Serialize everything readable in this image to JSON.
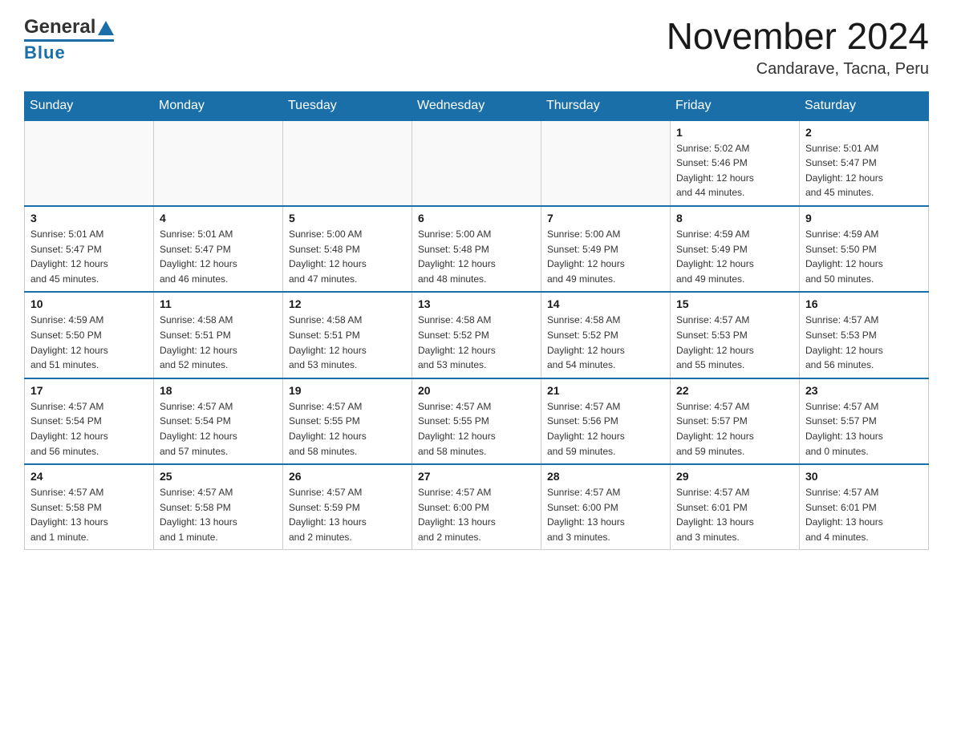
{
  "header": {
    "logo_general": "General",
    "logo_blue": "Blue",
    "title": "November 2024",
    "subtitle": "Candarave, Tacna, Peru"
  },
  "days_of_week": [
    "Sunday",
    "Monday",
    "Tuesday",
    "Wednesday",
    "Thursday",
    "Friday",
    "Saturday"
  ],
  "weeks": [
    {
      "days": [
        {
          "num": "",
          "info": ""
        },
        {
          "num": "",
          "info": ""
        },
        {
          "num": "",
          "info": ""
        },
        {
          "num": "",
          "info": ""
        },
        {
          "num": "",
          "info": ""
        },
        {
          "num": "1",
          "info": "Sunrise: 5:02 AM\nSunset: 5:46 PM\nDaylight: 12 hours\nand 44 minutes."
        },
        {
          "num": "2",
          "info": "Sunrise: 5:01 AM\nSunset: 5:47 PM\nDaylight: 12 hours\nand 45 minutes."
        }
      ]
    },
    {
      "days": [
        {
          "num": "3",
          "info": "Sunrise: 5:01 AM\nSunset: 5:47 PM\nDaylight: 12 hours\nand 45 minutes."
        },
        {
          "num": "4",
          "info": "Sunrise: 5:01 AM\nSunset: 5:47 PM\nDaylight: 12 hours\nand 46 minutes."
        },
        {
          "num": "5",
          "info": "Sunrise: 5:00 AM\nSunset: 5:48 PM\nDaylight: 12 hours\nand 47 minutes."
        },
        {
          "num": "6",
          "info": "Sunrise: 5:00 AM\nSunset: 5:48 PM\nDaylight: 12 hours\nand 48 minutes."
        },
        {
          "num": "7",
          "info": "Sunrise: 5:00 AM\nSunset: 5:49 PM\nDaylight: 12 hours\nand 49 minutes."
        },
        {
          "num": "8",
          "info": "Sunrise: 4:59 AM\nSunset: 5:49 PM\nDaylight: 12 hours\nand 49 minutes."
        },
        {
          "num": "9",
          "info": "Sunrise: 4:59 AM\nSunset: 5:50 PM\nDaylight: 12 hours\nand 50 minutes."
        }
      ]
    },
    {
      "days": [
        {
          "num": "10",
          "info": "Sunrise: 4:59 AM\nSunset: 5:50 PM\nDaylight: 12 hours\nand 51 minutes."
        },
        {
          "num": "11",
          "info": "Sunrise: 4:58 AM\nSunset: 5:51 PM\nDaylight: 12 hours\nand 52 minutes."
        },
        {
          "num": "12",
          "info": "Sunrise: 4:58 AM\nSunset: 5:51 PM\nDaylight: 12 hours\nand 53 minutes."
        },
        {
          "num": "13",
          "info": "Sunrise: 4:58 AM\nSunset: 5:52 PM\nDaylight: 12 hours\nand 53 minutes."
        },
        {
          "num": "14",
          "info": "Sunrise: 4:58 AM\nSunset: 5:52 PM\nDaylight: 12 hours\nand 54 minutes."
        },
        {
          "num": "15",
          "info": "Sunrise: 4:57 AM\nSunset: 5:53 PM\nDaylight: 12 hours\nand 55 minutes."
        },
        {
          "num": "16",
          "info": "Sunrise: 4:57 AM\nSunset: 5:53 PM\nDaylight: 12 hours\nand 56 minutes."
        }
      ]
    },
    {
      "days": [
        {
          "num": "17",
          "info": "Sunrise: 4:57 AM\nSunset: 5:54 PM\nDaylight: 12 hours\nand 56 minutes."
        },
        {
          "num": "18",
          "info": "Sunrise: 4:57 AM\nSunset: 5:54 PM\nDaylight: 12 hours\nand 57 minutes."
        },
        {
          "num": "19",
          "info": "Sunrise: 4:57 AM\nSunset: 5:55 PM\nDaylight: 12 hours\nand 58 minutes."
        },
        {
          "num": "20",
          "info": "Sunrise: 4:57 AM\nSunset: 5:55 PM\nDaylight: 12 hours\nand 58 minutes."
        },
        {
          "num": "21",
          "info": "Sunrise: 4:57 AM\nSunset: 5:56 PM\nDaylight: 12 hours\nand 59 minutes."
        },
        {
          "num": "22",
          "info": "Sunrise: 4:57 AM\nSunset: 5:57 PM\nDaylight: 12 hours\nand 59 minutes."
        },
        {
          "num": "23",
          "info": "Sunrise: 4:57 AM\nSunset: 5:57 PM\nDaylight: 13 hours\nand 0 minutes."
        }
      ]
    },
    {
      "days": [
        {
          "num": "24",
          "info": "Sunrise: 4:57 AM\nSunset: 5:58 PM\nDaylight: 13 hours\nand 1 minute."
        },
        {
          "num": "25",
          "info": "Sunrise: 4:57 AM\nSunset: 5:58 PM\nDaylight: 13 hours\nand 1 minute."
        },
        {
          "num": "26",
          "info": "Sunrise: 4:57 AM\nSunset: 5:59 PM\nDaylight: 13 hours\nand 2 minutes."
        },
        {
          "num": "27",
          "info": "Sunrise: 4:57 AM\nSunset: 6:00 PM\nDaylight: 13 hours\nand 2 minutes."
        },
        {
          "num": "28",
          "info": "Sunrise: 4:57 AM\nSunset: 6:00 PM\nDaylight: 13 hours\nand 3 minutes."
        },
        {
          "num": "29",
          "info": "Sunrise: 4:57 AM\nSunset: 6:01 PM\nDaylight: 13 hours\nand 3 minutes."
        },
        {
          "num": "30",
          "info": "Sunrise: 4:57 AM\nSunset: 6:01 PM\nDaylight: 13 hours\nand 4 minutes."
        }
      ]
    }
  ]
}
